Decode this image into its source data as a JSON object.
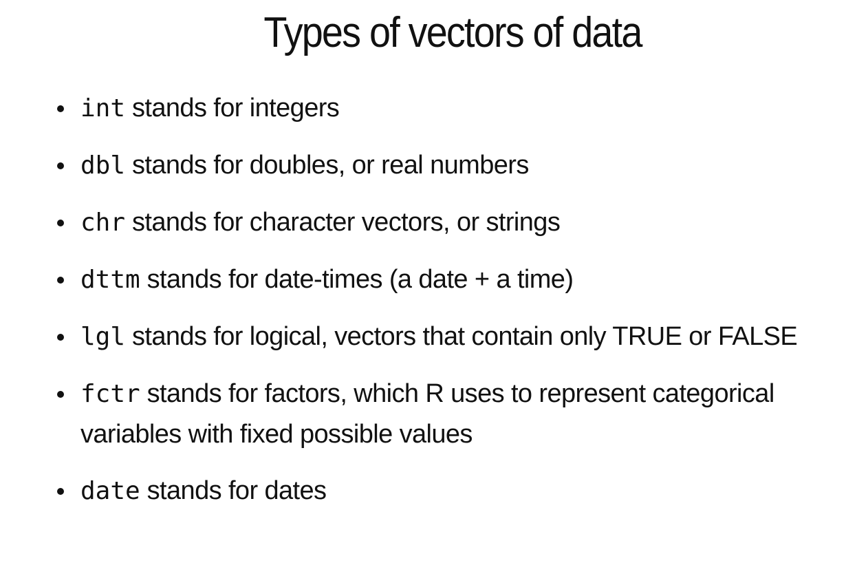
{
  "slide": {
    "title": "Types of vectors of data",
    "items": [
      {
        "code": "int",
        "text": " stands for integers"
      },
      {
        "code": "dbl",
        "text": " stands for doubles, or real numbers"
      },
      {
        "code": "chr",
        "text": " stands for character vectors, or strings"
      },
      {
        "code": "dttm",
        "text": " stands for date-times (a date + a time)"
      },
      {
        "code": "lgl",
        "text": " stands for logical, vectors that contain only TRUE or FALSE"
      },
      {
        "code": "fctr",
        "text": " stands for factors, which R uses to represent categorical variables with fixed possible values"
      },
      {
        "code": "date",
        "text": " stands for dates"
      }
    ]
  }
}
